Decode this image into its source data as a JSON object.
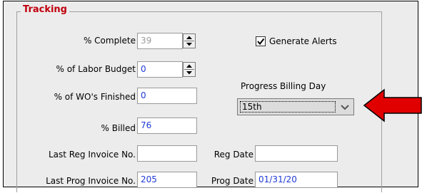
{
  "group": {
    "title": "Tracking"
  },
  "fields": {
    "percent_complete": {
      "label": "% Complete",
      "value": "39"
    },
    "percent_labor_budget": {
      "label": "% of Labor Budget",
      "value": "0"
    },
    "percent_wo_finished": {
      "label": "% of WO's Finished",
      "value": "0"
    },
    "percent_billed": {
      "label": "% Billed",
      "value": "76"
    },
    "last_reg_invoice": {
      "label": "Last Reg Invoice No.",
      "value": ""
    },
    "reg_date": {
      "label": "Reg Date",
      "value": ""
    },
    "last_prog_invoice": {
      "label": "Last Prog Invoice No.",
      "value": "205"
    },
    "prog_date": {
      "label": "Prog Date",
      "value": "01/31/20"
    }
  },
  "generate_alerts": {
    "label": "Generate Alerts",
    "checked": true
  },
  "progress_billing_day": {
    "label": "Progress Billing Day",
    "selected": "15th"
  },
  "colors": {
    "group_title": "#c0000c",
    "field_value": "#1f3ad8",
    "arrow": "#e00000"
  },
  "icons": [
    "spin-up-down-icon",
    "checkbox-checked-icon",
    "chevron-down-icon",
    "red-arrow-icon"
  ]
}
